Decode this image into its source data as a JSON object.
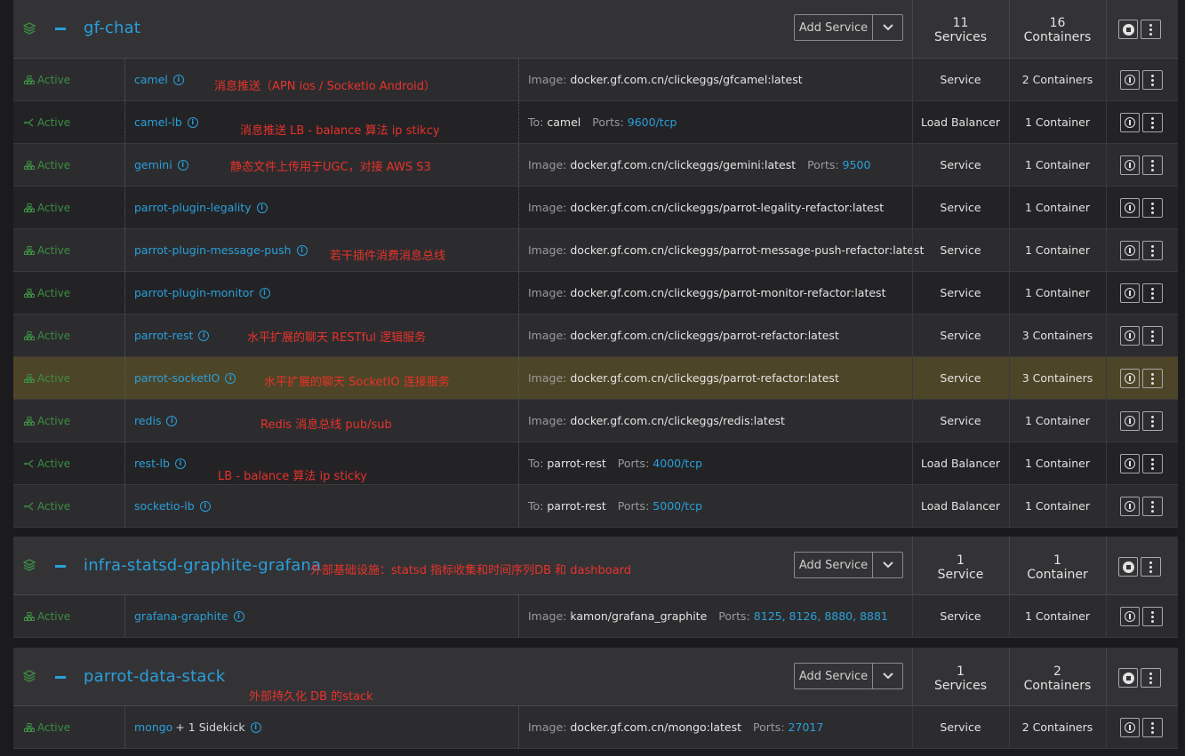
{
  "stacks": [
    {
      "name": "gf-chat",
      "note": "",
      "add_service": "Add Service",
      "services_count": "11",
      "services_label": "Services",
      "containers_count": "16",
      "containers_label": "Containers",
      "rows": [
        {
          "state": "Active",
          "state_icon": "service-icon",
          "name": "camel",
          "note": "消息推送（APN ios / Socketio Android）",
          "detail_key": "Image:",
          "detail_val": "docker.gf.com.cn/clickeggs/gfcamel:latest",
          "ports": "",
          "kind": "Service",
          "containers": "2 Containers"
        },
        {
          "state": "Active",
          "state_icon": "load-balancer-icon",
          "name": "camel-lb",
          "note": "消息推送 LB - balance 算法 ip stikcy",
          "detail_key": "To:",
          "detail_val": "camel",
          "ports": "9600/tcp",
          "kind": "Load Balancer",
          "containers": "1 Container"
        },
        {
          "state": "Active",
          "state_icon": "service-icon",
          "name": "gemini",
          "note": "静态文件上传用于UGC，对接 AWS S3",
          "detail_key": "Image:",
          "detail_val": "docker.gf.com.cn/clickeggs/gemini:latest",
          "ports": "9500",
          "kind": "Service",
          "containers": "1 Container"
        },
        {
          "state": "Active",
          "state_icon": "service-icon",
          "name": "parrot-plugin-legality",
          "note": "",
          "detail_key": "Image:",
          "detail_val": "docker.gf.com.cn/clickeggs/parrot-legality-refactor:latest",
          "ports": "",
          "kind": "Service",
          "containers": "1 Container"
        },
        {
          "state": "Active",
          "state_icon": "service-icon",
          "name": "parrot-plugin-message-push",
          "note": "若干插件消费消息总线",
          "detail_key": "Image:",
          "detail_val": "docker.gf.com.cn/clickeggs/parrot-message-push-refactor:latest",
          "ports": "",
          "kind": "Service",
          "containers": "1 Container"
        },
        {
          "state": "Active",
          "state_icon": "service-icon",
          "name": "parrot-plugin-monitor",
          "note": "",
          "detail_key": "Image:",
          "detail_val": "docker.gf.com.cn/clickeggs/parrot-monitor-refactor:latest",
          "ports": "",
          "kind": "Service",
          "containers": "1 Container"
        },
        {
          "state": "Active",
          "state_icon": "service-icon",
          "name": "parrot-rest",
          "note": "水平扩展的聊天 RESTful 逻辑服务",
          "detail_key": "Image:",
          "detail_val": "docker.gf.com.cn/clickeggs/parrot-refactor:latest",
          "ports": "",
          "kind": "Service",
          "containers": "3 Containers"
        },
        {
          "state": "Active",
          "state_icon": "service-icon",
          "name": "parrot-socketIO",
          "note": "水平扩展的聊天 SocketIO 连接服务",
          "detail_key": "Image:",
          "detail_val": "docker.gf.com.cn/clickeggs/parrot-refactor:latest",
          "ports": "",
          "kind": "Service",
          "containers": "3 Containers"
        },
        {
          "state": "Active",
          "state_icon": "service-icon",
          "name": "redis",
          "note": "Redis 消息总线 pub/sub",
          "detail_key": "Image:",
          "detail_val": "docker.gf.com.cn/clickeggs/redis:latest",
          "ports": "",
          "kind": "Service",
          "containers": "1 Container"
        },
        {
          "state": "Active",
          "state_icon": "load-balancer-icon",
          "name": "rest-lb",
          "note": "LB - balance 算法 ip sticky",
          "detail_key": "To:",
          "detail_val": "parrot-rest",
          "ports": "4000/tcp",
          "kind": "Load Balancer",
          "containers": "1 Container"
        },
        {
          "state": "Active",
          "state_icon": "load-balancer-icon",
          "name": "socketio-lb",
          "note": "",
          "detail_key": "To:",
          "detail_val": "parrot-rest",
          "ports": "5000/tcp",
          "kind": "Load Balancer",
          "containers": "1 Container"
        }
      ]
    },
    {
      "name": "infra-statsd-graphite-grafana",
      "note": "外部基础设施：statsd 指标收集和时间序列DB 和 dashboard",
      "add_service": "Add Service",
      "services_count": "1",
      "services_label": "Service",
      "containers_count": "1",
      "containers_label": "Container",
      "rows": [
        {
          "state": "Active",
          "state_icon": "service-icon",
          "name": "grafana-graphite",
          "note": "",
          "detail_key": "Image:",
          "detail_val": "kamon/grafana_graphite",
          "ports": "8125, 8126, 8880, 8881",
          "kind": "Service",
          "containers": "1 Container"
        }
      ]
    },
    {
      "name": "parrot-data-stack",
      "note": "外部持久化 DB 的stack",
      "add_service": "Add Service",
      "services_count": "1",
      "services_label": "Services",
      "containers_count": "2",
      "containers_label": "Containers",
      "rows": [
        {
          "state": "Active",
          "state_icon": "service-icon",
          "name": "mongo",
          "sidekick": "+ 1 Sidekick",
          "note": "",
          "detail_key": "Image:",
          "detail_val": "docker.gf.com.cn/mongo:latest",
          "ports": "27017",
          "kind": "Service",
          "containers": "2 Containers"
        }
      ]
    }
  ],
  "labels": {
    "ports": "Ports:",
    "info": "i"
  },
  "colors": {
    "accent": "#2a9fd8",
    "active": "#3c8d42",
    "annotation": "#e8322a",
    "highlight_row": "#4d4527"
  }
}
